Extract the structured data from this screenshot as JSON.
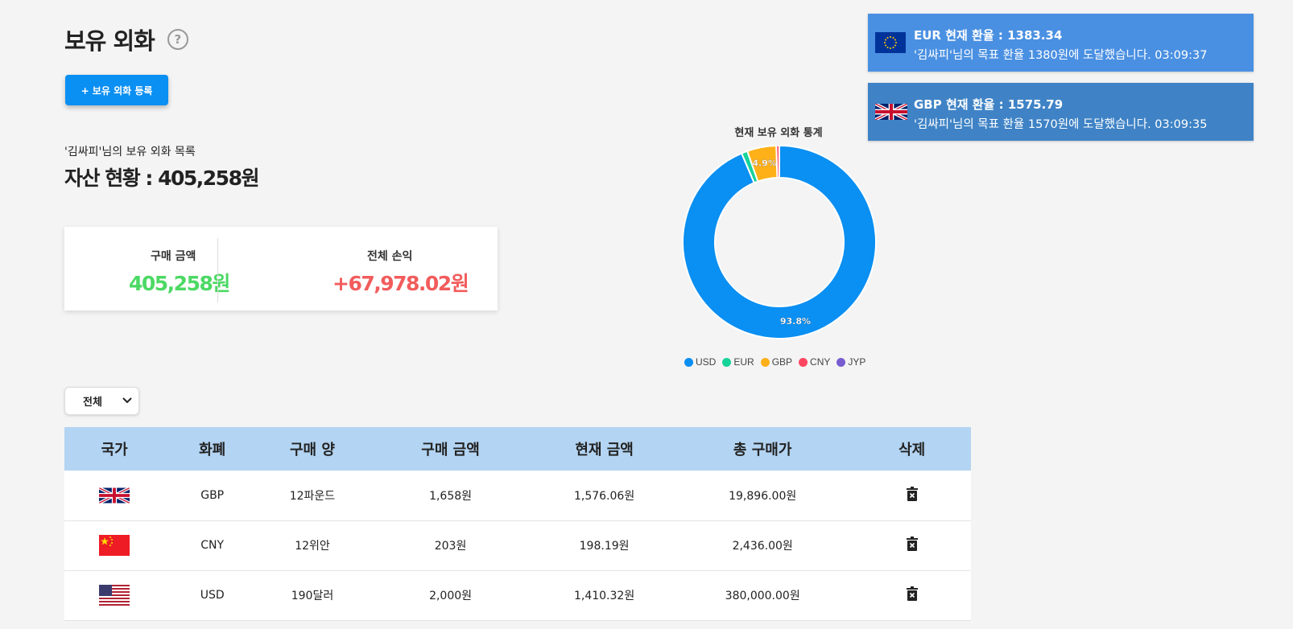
{
  "header": {
    "title": "보유 외화",
    "help_icon": "question-circle-icon",
    "register_button": "+ 보유 외화 등록"
  },
  "summary": {
    "list_caption": "'김싸피'님의 보유 외화 목록",
    "asset_label": "자산 현황 : ",
    "asset_value": "405,258원",
    "purchase_label": "구매 금액",
    "purchase_value": "405,258원",
    "profit_label": "전체 손익",
    "profit_value": "+67,978.02원",
    "purchase_color": "#4cd964",
    "profit_color": "#f25c5c"
  },
  "chart_data": {
    "type": "pie",
    "title": "현재 보유 외화 통계",
    "categories": [
      "USD",
      "EUR",
      "GBP",
      "CNY",
      "JYP"
    ],
    "values": [
      93.8,
      1.0,
      4.9,
      0.5,
      0.0
    ],
    "colors": [
      "#0a8ff2",
      "#16d39a",
      "#feb019",
      "#ff4560",
      "#775dd0"
    ],
    "data_labels": [
      "93.8%",
      "",
      "4.9%",
      "",
      ""
    ],
    "legend_position": "bottom"
  },
  "filter": {
    "selected": "전체"
  },
  "table": {
    "headers": [
      "국가",
      "화폐",
      "구매 양",
      "구매 금액",
      "현재 금액",
      "총 구매가",
      "삭제"
    ],
    "rows": [
      {
        "flag": "uk-flag-icon",
        "currency": "GBP",
        "amount": "12파운드",
        "purchase": "1,658원",
        "current": "1,576.06원",
        "total": "19,896.00원"
      },
      {
        "flag": "china-flag-icon",
        "currency": "CNY",
        "amount": "12위안",
        "purchase": "203원",
        "current": "198.19원",
        "total": "2,436.00원"
      },
      {
        "flag": "usa-flag-icon",
        "currency": "USD",
        "amount": "190달러",
        "purchase": "2,000원",
        "current": "1,410.32원",
        "total": "380,000.00원"
      }
    ],
    "delete_icon": "trash-icon"
  },
  "notifications": [
    {
      "flag": "eu-flag-icon",
      "title": "EUR 현재 환율 : 1383.34",
      "message": "'김싸피'님의 목표 환율 1380원에 도달했습니다.  03:09:37",
      "color": "#4a90e2"
    },
    {
      "flag": "uk-flag-icon",
      "title": "GBP 현재 환율 : 1575.79",
      "message": "'김싸피'님의 목표 환율 1570원에 도달했습니다.  03:09:35",
      "color": "#3f83c6"
    }
  ]
}
